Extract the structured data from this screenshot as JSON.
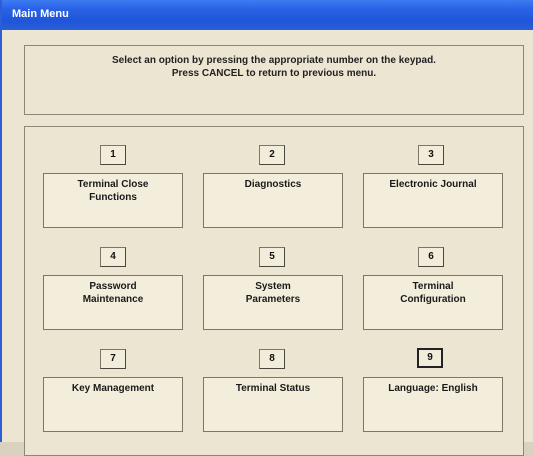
{
  "window": {
    "title": "Main Menu"
  },
  "instructions": {
    "line1": "Select an option by pressing the appropriate number on the keypad.",
    "line2": "Press CANCEL to return to previous menu."
  },
  "options": [
    {
      "key": "1",
      "label_line1": "Terminal Close",
      "label_line2": "Functions"
    },
    {
      "key": "2",
      "label_line1": "Diagnostics",
      "label_line2": ""
    },
    {
      "key": "3",
      "label_line1": "Electronic Journal",
      "label_line2": ""
    },
    {
      "key": "4",
      "label_line1": "Password",
      "label_line2": "Maintenance"
    },
    {
      "key": "5",
      "label_line1": "System",
      "label_line2": "Parameters"
    },
    {
      "key": "6",
      "label_line1": "Terminal",
      "label_line2": "Configuration"
    },
    {
      "key": "7",
      "label_line1": "Key Management",
      "label_line2": ""
    },
    {
      "key": "8",
      "label_line1": "Terminal Status",
      "label_line2": ""
    },
    {
      "key": "9",
      "label_line1": "Language: English",
      "label_line2": ""
    }
  ],
  "colors": {
    "titlebar": "#2a62e6",
    "panel": "#ece5d2",
    "border": "#8c8878"
  }
}
